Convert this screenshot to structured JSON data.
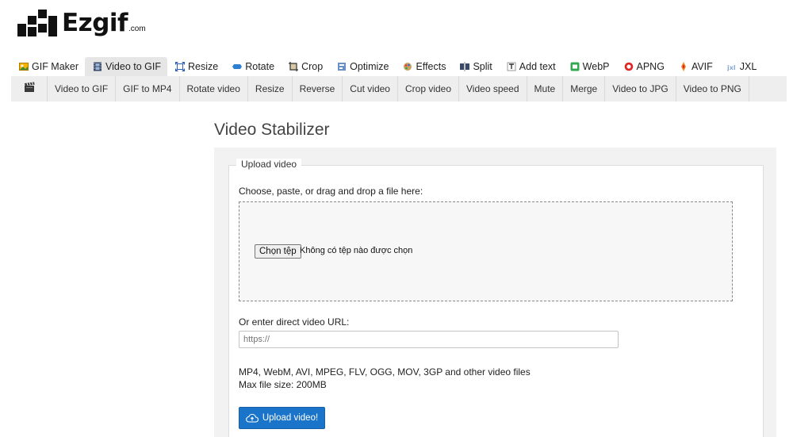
{
  "logo": {
    "text": "Ezgif",
    "suffix": ".com"
  },
  "main_nav": [
    {
      "label": "GIF Maker",
      "icon": "gif-maker-icon",
      "active": false
    },
    {
      "label": "Video to GIF",
      "icon": "film-icon",
      "active": true
    },
    {
      "label": "Resize",
      "icon": "resize-icon",
      "active": false
    },
    {
      "label": "Rotate",
      "icon": "rotate-icon",
      "active": false
    },
    {
      "label": "Crop",
      "icon": "crop-icon",
      "active": false
    },
    {
      "label": "Optimize",
      "icon": "optimize-icon",
      "active": false
    },
    {
      "label": "Effects",
      "icon": "effects-icon",
      "active": false
    },
    {
      "label": "Split",
      "icon": "split-icon",
      "active": false
    },
    {
      "label": "Add text",
      "icon": "add-text-icon",
      "active": false
    },
    {
      "label": "WebP",
      "icon": "webp-icon",
      "active": false
    },
    {
      "label": "APNG",
      "icon": "apng-icon",
      "active": false
    },
    {
      "label": "AVIF",
      "icon": "avif-icon",
      "active": false
    },
    {
      "label": "JXL",
      "icon": "jxl-icon",
      "active": false
    }
  ],
  "sub_nav": {
    "icon": "clapperboard-icon",
    "items": [
      "Video to GIF",
      "GIF to MP4",
      "Rotate video",
      "Resize",
      "Reverse",
      "Cut video",
      "Crop video",
      "Video speed",
      "Mute",
      "Merge",
      "Video to JPG",
      "Video to PNG"
    ]
  },
  "page": {
    "title": "Video Stabilizer",
    "legend": "Upload video",
    "choose_label": "Choose, paste, or drag and drop a file here:",
    "file_button": "Chọn tệp",
    "file_status": "Không có tệp nào được chọn",
    "url_label": "Or enter direct video URL:",
    "url_placeholder": "https://",
    "formats": "MP4, WebM, AVI, MPEG, FLV, OGG, MOV, 3GP and other video files",
    "max_size": "Max file size: 200MB",
    "upload_button": "Upload video!"
  },
  "colors": {
    "accent": "#1a74c9",
    "panel": "#f2f2f2",
    "subnav": "#eeeeee"
  }
}
